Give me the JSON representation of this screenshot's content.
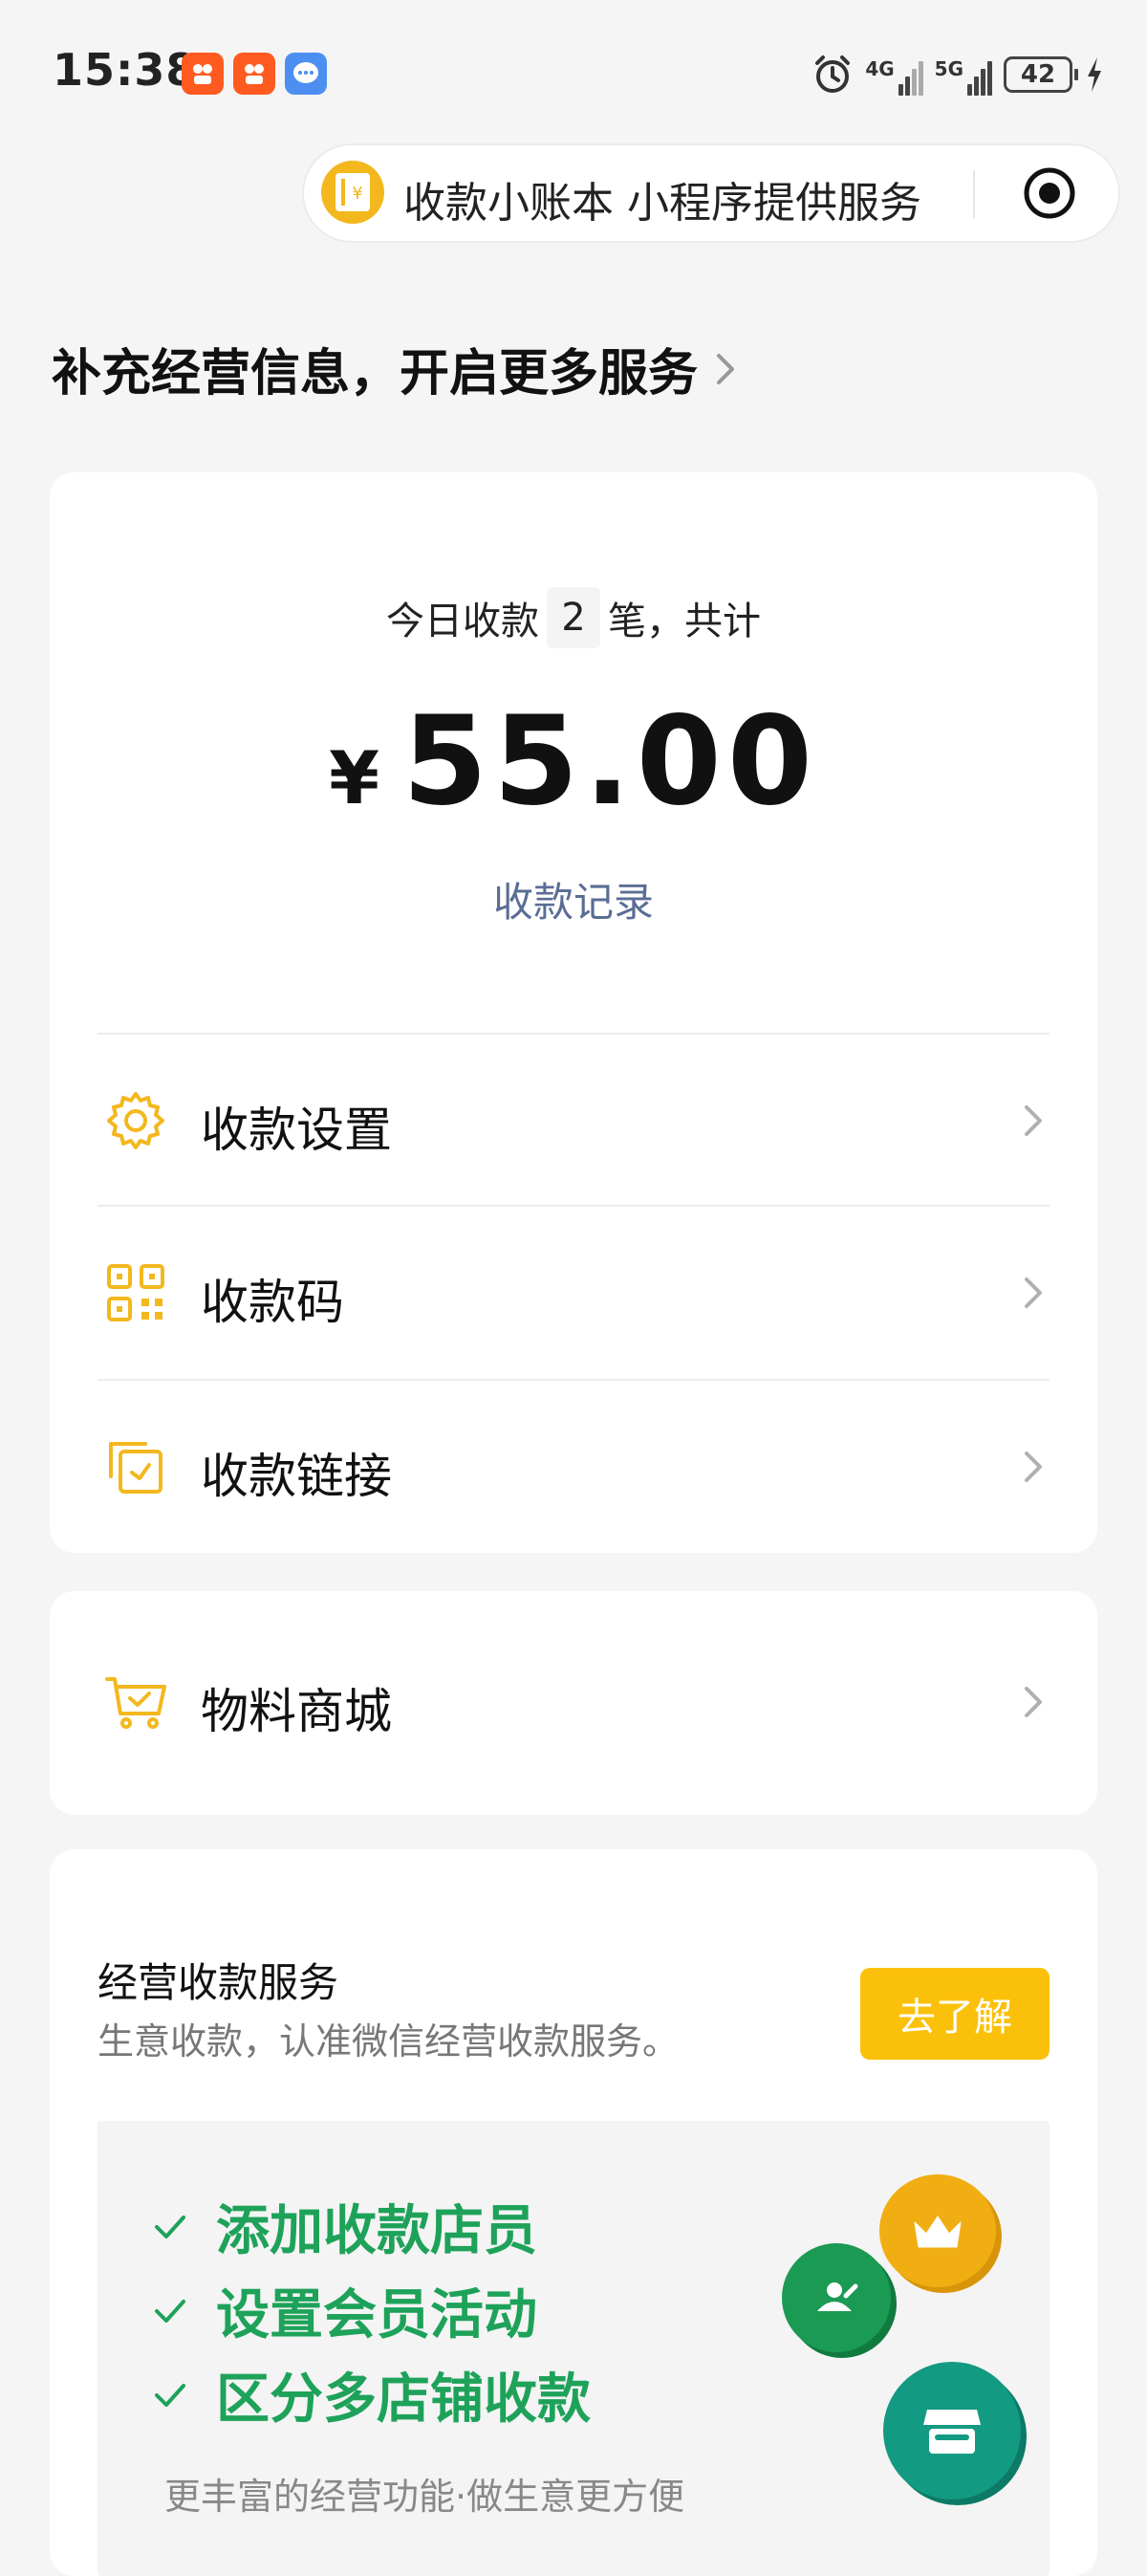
{
  "status_bar": {
    "time": "15:38",
    "network_1": "4G",
    "network_2": "5G",
    "battery": "42"
  },
  "capsule": {
    "title": "收款小账本 小程序提供服务",
    "logo_glyph": "¥"
  },
  "headline": "补充经营信息，开启更多服务",
  "summary": {
    "prefix": "今日收款",
    "count": "2",
    "suffix": "笔，共计",
    "currency": "¥",
    "amount": "55.00",
    "records_link": "收款记录"
  },
  "menu": {
    "settings": "收款设置",
    "qr_code": "收款码",
    "payment_link": "收款链接",
    "materials_shop": "物料商城"
  },
  "service": {
    "title": "经营收款服务",
    "subtitle": "生意收款，认准微信经营收款服务。",
    "learn_button": "去了解",
    "features": [
      "添加收款店员",
      "设置会员活动",
      "区分多店铺收款"
    ],
    "footer": "更丰富的经营功能·做生意更方便"
  },
  "colors": {
    "accent_yellow": "#fbc10a",
    "icon_yellow": "#f3b81e",
    "link_blue": "#5a6d95",
    "feature_green": "#1ea25a"
  },
  "icons": [
    "alarm-icon",
    "gear-icon",
    "qr-code-icon",
    "link-icon",
    "cart-icon",
    "check-icon",
    "crown-icon",
    "person-icon",
    "store-icon"
  ]
}
